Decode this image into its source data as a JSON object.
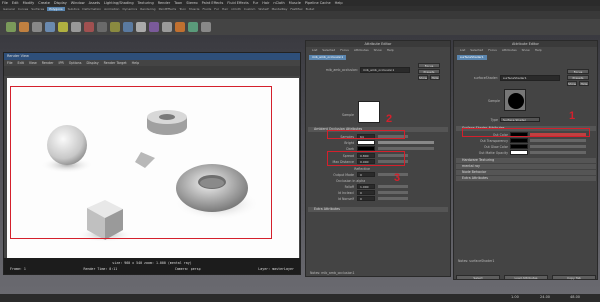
{
  "menubar": [
    "File",
    "Edit",
    "Modify",
    "Create",
    "Display",
    "Window",
    "Assets",
    "Lighting/Shading",
    "Texturing",
    "Render",
    "Toon",
    "Stereo",
    "Paint Effects",
    "Fluid Effects",
    "Fur",
    "Hair",
    "nCloth",
    "Muscle",
    "Pipeline Cache",
    "Help"
  ],
  "shelf_tabs": [
    "General",
    "Curves",
    "Surfaces",
    "Polygons",
    "Subdivs",
    "Deformation",
    "Animation",
    "Dynamics",
    "Rendering",
    "PaintEffects",
    "Toon",
    "Muscle",
    "Fluids",
    "Fur",
    "Hair",
    "nCloth",
    "Custom",
    "Wshelf",
    "MentalRay",
    "FastMax",
    "Bullet"
  ],
  "render_view": {
    "title": "Render View",
    "menu": [
      "File",
      "Edit",
      "View",
      "Render",
      "IPR",
      "Options",
      "Display",
      "Render Target",
      "Help"
    ],
    "status_line1": "size: 960 x 540 zoom: 1.000 (mental ray)",
    "status_line2_left": "Frame: 1",
    "status_line2_mid1": "Render Time: 0:11",
    "status_line2_mid2": "Camera: persp",
    "status_line2_right": "Layer: masterLayer"
  },
  "ae_center": {
    "title": "Attribute Editor",
    "menu": [
      "List",
      "Selected",
      "Focus",
      "Attributes",
      "Show",
      "Help"
    ],
    "tab": "mib_amb_occlusion1",
    "node_label": "mib_amb_occlusion:",
    "node_value": "mib_amb_occlusion1",
    "focus": "Focus",
    "presets": "Presets",
    "show": "Show",
    "hide": "Hide",
    "sample_label": "Sample",
    "section_attrs": "Ambient Occlusion Attributes",
    "samples_label": "Samples",
    "samples_value": "64",
    "bright_label": "Bright",
    "dark_label": "Dark",
    "spread_label": "Spread",
    "spread_value": "0.800",
    "maxdist_label": "Max Distance",
    "maxdist_value": "0.000",
    "reflective_label": "Reflective",
    "output_label": "Output Mode",
    "output_value": "0",
    "occlusion_label": "Occlusion in alpha",
    "falloff_label": "Falloff",
    "falloff_value": "1.000",
    "idinclexcl_label": "Id Inclexcl",
    "idinclexcl_value": "0",
    "idnonself_label": "Id Nonself",
    "idnonself_value": "0",
    "extra_label": "Extra Attributes",
    "notes_label": "Notes: mib_amb_occlusion1"
  },
  "ae_right": {
    "title": "Attribute Editor",
    "menu": [
      "List",
      "Selected",
      "Focus",
      "Attributes",
      "Show",
      "Help"
    ],
    "tab": "surfaceShader1",
    "node_label": "surfaceShader:",
    "node_value": "surfaceShader1",
    "focus": "Focus",
    "presets": "Presets",
    "show": "Show",
    "hide": "Hide",
    "sample_label": "Sample",
    "type_label": "Type",
    "type_value": "Surface Shader",
    "section_attrs": "Surface Shader Attributes",
    "outcolor_label": "Out Color",
    "outtransp_label": "Out Transparency",
    "outglow_label": "Out Glow Color",
    "outmatte_label": "Out Matte Opacity",
    "hw_label": "Hardware Texturing",
    "mentalray_label": "mental ray",
    "nodebeh_label": "Node Behavior",
    "extra_label": "Extra Attributes",
    "notes_label": "Notes: surfaceShader1",
    "select_btn": "Select",
    "load_btn": "Load Attributes",
    "copy_btn": "Copy Tab"
  },
  "callouts": [
    "1",
    "2",
    "3"
  ],
  "timeline": {
    "start": "1.00",
    "end": "24.00",
    "end2": "48.00"
  },
  "colors": {
    "accent": "#5a86b0",
    "callout": "#d4202c",
    "panel": "#444444"
  }
}
